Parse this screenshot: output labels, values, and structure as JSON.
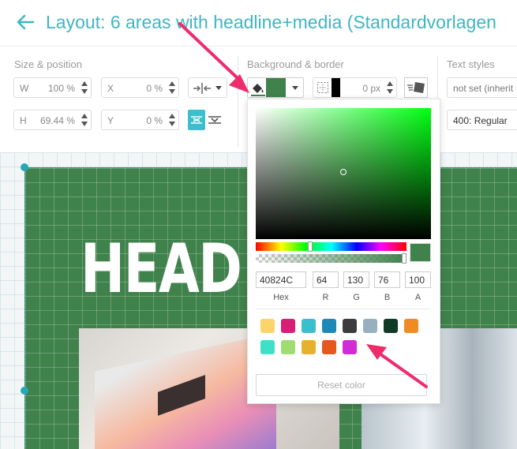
{
  "header": {
    "title": "Layout: 6 areas with headline+media (Standardvorlagen"
  },
  "size_position": {
    "label": "Size & position",
    "w_label": "W",
    "w_value": "100 %",
    "x_label": "X",
    "x_value": "0 %",
    "h_label": "H",
    "h_value": "69.44 %",
    "y_label": "Y",
    "y_value": "0 %"
  },
  "background_border": {
    "label": "Background & border",
    "fill_color": "#40824c",
    "border_color": "#000000",
    "border_value": "0 px"
  },
  "text_styles": {
    "label": "Text styles",
    "style_value": "not set (inherit",
    "weight_value": "400: Regular"
  },
  "canvas": {
    "headline": "HEAD"
  },
  "color_picker": {
    "hex": "40824C",
    "r": "64",
    "g": "130",
    "b": "76",
    "a": "100",
    "hex_label": "Hex",
    "r_label": "R",
    "g_label": "G",
    "b_label": "B",
    "a_label": "A",
    "swatches": [
      "#fdd36b",
      "#d81e76",
      "#3bbfcf",
      "#1e88b6",
      "#3c3c3c",
      "#98afbf",
      "#0f3a25",
      "#f08a23",
      "#3ee0c8",
      "#9fdc72",
      "#e6b22e",
      "#e45a1e",
      "#d22bd6"
    ],
    "reset_label": "Reset color"
  }
}
